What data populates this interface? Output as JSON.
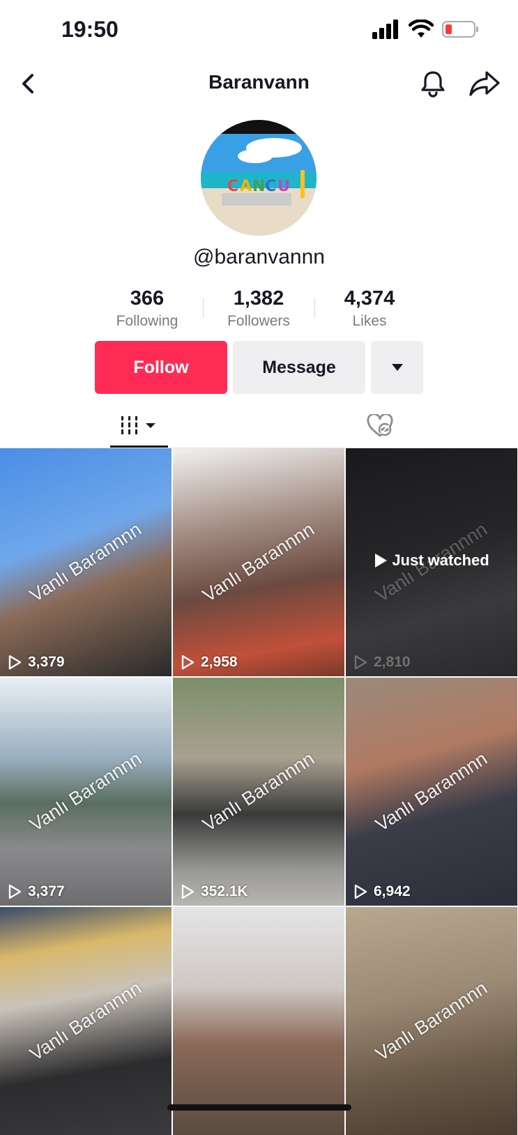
{
  "status": {
    "time": "19:50"
  },
  "nav": {
    "title": "Baranvann"
  },
  "profile": {
    "handle": "@baranvannn"
  },
  "stats": [
    {
      "value": "366",
      "label": "Following"
    },
    {
      "value": "1,382",
      "label": "Followers"
    },
    {
      "value": "4,374",
      "label": "Likes"
    }
  ],
  "actions": {
    "follow": "Follow",
    "message": "Message"
  },
  "watermark": "Vanlı Barannnn",
  "videos": [
    {
      "views": "3,379"
    },
    {
      "views": "2,958"
    },
    {
      "views": "2,810",
      "badge": "Just watched"
    },
    {
      "views": "3,377"
    },
    {
      "views": "352.1K"
    },
    {
      "views": "6,942"
    },
    {
      "views": "",
      "note": "partially cut"
    },
    {
      "views": ""
    },
    {
      "views": ""
    }
  ],
  "colors": {
    "accent": "#fe2c55",
    "text": "#161823",
    "muted": "#7b7b80"
  }
}
